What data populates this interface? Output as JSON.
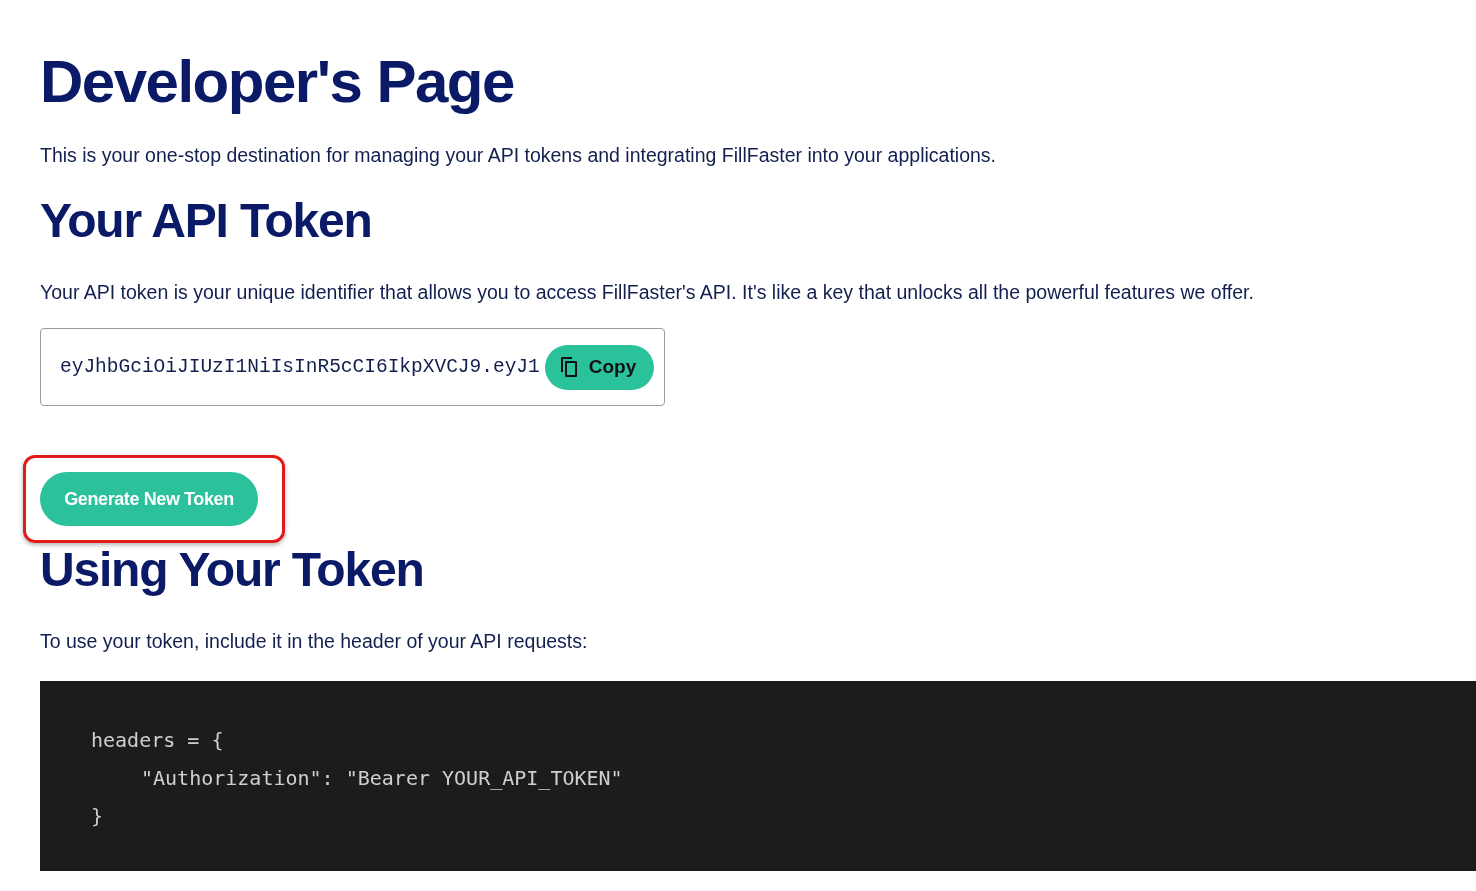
{
  "title": "Developer's Page",
  "intro": "This is your one-stop destination for managing your API tokens and integrating FillFaster into your applications.",
  "token_section": {
    "heading": "Your API Token",
    "description": "Your API token is your unique identifier that allows you to access FillFaster's API. It's like a key that unlocks all the powerful features we offer.",
    "token": "eyJhbGciOiJIUzI1NiIsInR5cCI6IkpXVCJ9.eyJ1",
    "copy_button": "Copy"
  },
  "generate_button": {
    "label": "Generate New Token",
    "highlighted": true
  },
  "usage_section": {
    "heading": "Using Your Token",
    "description": "To use your token, include it in the header of your API requests:",
    "code_lines": [
      {
        "text": "headers = {",
        "indent": false
      },
      {
        "text": "\"Authorization\": \"Bearer YOUR_API_TOKEN\"",
        "indent": true
      },
      {
        "text": "}",
        "indent": false
      }
    ]
  }
}
